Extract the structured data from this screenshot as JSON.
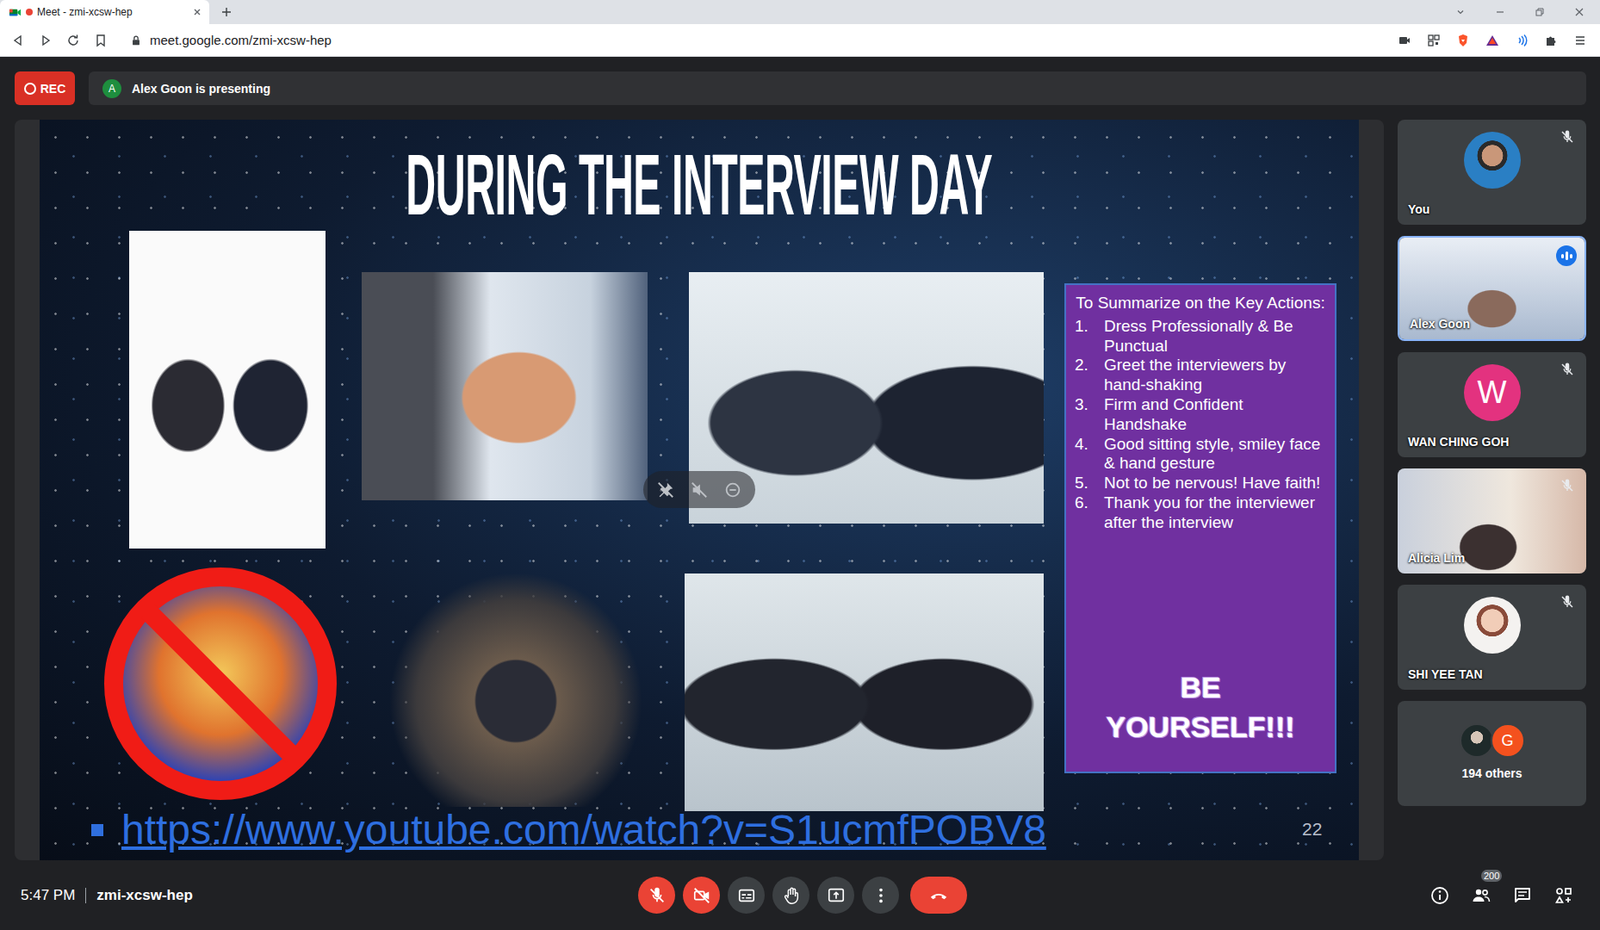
{
  "browser": {
    "tab": {
      "title": "Meet - zmi-xcsw-hep",
      "recording": true
    },
    "url": "meet.google.com/zmi-xcsw-hep"
  },
  "meeting": {
    "rec_label": "REC",
    "presenter_initial": "A",
    "presenting_text": "Alex Goon is presenting"
  },
  "slide": {
    "title": "DURING THE INTERVIEW DAY",
    "summary_heading": "To Summarize on the Key Actions:",
    "actions": [
      {
        "number": "1.",
        "text": "Dress Professionally & Be Punctual"
      },
      {
        "number": "2.",
        "text": "Greet the interviewers by hand-shaking"
      },
      {
        "number": "3.",
        "text": "Firm and Confident Handshake"
      },
      {
        "number": "4.",
        "text": "Good sitting style, smiley face & hand gesture"
      },
      {
        "number": "5.",
        "text": "Not to be nervous! Have faith!"
      },
      {
        "number": "6.",
        "text": "Thank you for the interviewer after the interview"
      }
    ],
    "slogan": [
      "BE",
      "YOURSELF!!!"
    ],
    "link": "https://www.youtube.com/watch?v=S1ucmfPOBV8",
    "page_number": "22"
  },
  "participants": [
    {
      "name": "You",
      "kind": "photo",
      "muted": true,
      "speaking": false
    },
    {
      "name": "Alex Goon",
      "kind": "video",
      "muted": false,
      "speaking": true
    },
    {
      "name": "WAN CHING GOH",
      "kind": "initial",
      "initial": "W",
      "color": "#e3327f",
      "muted": true,
      "speaking": false
    },
    {
      "name": "Alicia Lim",
      "kind": "video",
      "muted": true,
      "speaking": false
    },
    {
      "name": "SHI YEE TAN",
      "kind": "photo",
      "muted": true,
      "speaking": false
    },
    {
      "name": "194 others",
      "kind": "others",
      "initial": "G",
      "color": "#f4511e",
      "muted": false,
      "speaking": false
    }
  ],
  "footer": {
    "time": "5:47 PM",
    "meeting_code": "zmi-xcsw-hep"
  },
  "controls": [
    {
      "kind": "microphone",
      "on": false
    },
    {
      "kind": "camera",
      "on": false
    },
    {
      "kind": "captions",
      "on": false
    },
    {
      "kind": "hand",
      "on": false
    },
    {
      "kind": "present",
      "on": false
    },
    {
      "kind": "more",
      "on": false
    },
    {
      "kind": "leave",
      "on": false
    }
  ],
  "side_buttons": [
    {
      "kind": "info",
      "badge": ""
    },
    {
      "kind": "people",
      "badge": "200"
    },
    {
      "kind": "chat",
      "badge": ""
    },
    {
      "kind": "activities",
      "badge": ""
    }
  ]
}
